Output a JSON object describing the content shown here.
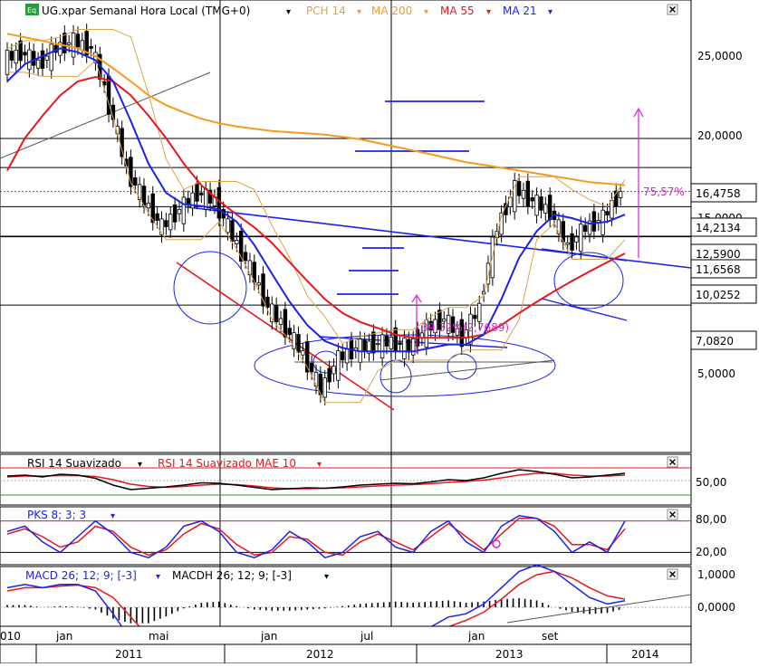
{
  "colors": {
    "pch": "#d9a44a",
    "ma200": "#f59a1f",
    "ma55": "#e8171c",
    "ma21": "#1b22e8",
    "annotation": "#e020d0",
    "rsi": "#000000",
    "rsi_mae": "#e8171c",
    "stoch_k": "#1b22e8",
    "stoch_d": "#e8171c",
    "macd": "#1b22e8",
    "signal": "#e8171c",
    "grid": "#000000",
    "background": "#ffffff"
  },
  "main_panel": {
    "icon_label": "Eq",
    "title": "UG.xpar Semanal Hora Local (TMG+0)",
    "legend": [
      {
        "label": "PCH 14",
        "color": "#d9a44a"
      },
      {
        "label": "MA 200",
        "color": "#f59a1f"
      },
      {
        "label": "MA 55",
        "color": "#e8171c"
      },
      {
        "label": "MA 21",
        "color": "#1b22e8"
      }
    ],
    "y_ticks": [
      "25,0000",
      "20,0000",
      "15,0000",
      "5,0000"
    ],
    "price_boxes": [
      "16,4758",
      "14,2134",
      "12,5900",
      "11,6568",
      "10,0252",
      "7,0820"
    ],
    "annotations": {
      "drop_pct": "39,32%(2,7689)",
      "rise_pct": "75,57%"
    },
    "close_icon": "close-icon"
  },
  "rsi_panel": {
    "legend": [
      {
        "label": "RSI 14 Suavizado",
        "color": "#000000"
      },
      {
        "label": "RSI 14 Suavizado MAE 10",
        "color": "#e8171c"
      }
    ],
    "y_ticks": [
      "50,00"
    ]
  },
  "stoch_panel": {
    "legend": [
      {
        "label": "PKS 8; 3; 3",
        "color": "#1b22e8"
      }
    ],
    "y_ticks": [
      "80,00",
      "20,00"
    ]
  },
  "macd_panel": {
    "legend": [
      {
        "label": "MACD 26; 12; 9; [-3]",
        "color": "#1b22e8"
      },
      {
        "label": "MACDH 26; 12; 9; [-3]",
        "color": "#000000"
      }
    ],
    "y_ticks": [
      "1,0000",
      "0,0000"
    ]
  },
  "x_axis": {
    "months": [
      "010",
      "jan",
      "mai",
      "jan",
      "jul",
      "jan",
      "set"
    ],
    "years": [
      "2011",
      "2012",
      "2013",
      "2014"
    ]
  },
  "chart_data": [
    {
      "type": "candlestick",
      "title": "UG.xpar Semanal Hora Local (TMG+0)",
      "ylim": [
        3.5,
        30.0
      ],
      "y_scale": "log",
      "x": [
        "2010-11",
        "2011-01",
        "2011-02",
        "2011-04",
        "2011-05",
        "2011-06",
        "2011-07",
        "2011-08",
        "2011-09",
        "2011-10",
        "2011-11",
        "2011-12",
        "2012-01",
        "2012-02",
        "2012-03",
        "2012-04",
        "2012-05",
        "2012-06",
        "2012-07",
        "2012-08",
        "2012-09",
        "2012-10",
        "2012-11",
        "2012-12",
        "2013-01",
        "2013-02",
        "2013-03",
        "2013-04",
        "2013-05",
        "2013-06",
        "2013-07",
        "2013-08",
        "2013-09",
        "2013-10",
        "2013-11",
        "2013-12"
      ],
      "close": [
        24.5,
        25.5,
        24.0,
        26.0,
        27.0,
        26.0,
        19.5,
        14.0,
        12.0,
        10.5,
        11.5,
        12.5,
        12.0,
        10.0,
        8.5,
        7.0,
        6.3,
        5.5,
        4.6,
        5.4,
        5.7,
        5.8,
        5.9,
        5.7,
        6.3,
        6.6,
        6.0,
        7.0,
        10.5,
        12.8,
        12.0,
        11.4,
        9.5,
        10.5,
        11.0,
        12.6
      ],
      "ma21": [
        22.0,
        24.0,
        25.0,
        26.0,
        25.5,
        24.5,
        22.0,
        18.0,
        14.5,
        12.5,
        11.8,
        11.7,
        11.5,
        10.8,
        9.6,
        8.3,
        7.2,
        6.4,
        5.9,
        5.7,
        5.6,
        5.6,
        5.6,
        5.6,
        5.7,
        5.8,
        5.8,
        6.1,
        7.3,
        9.0,
        10.3,
        11.2,
        11.0,
        10.7,
        10.8,
        11.2
      ],
      "ma55": [
        14.0,
        16.5,
        18.5,
        20.5,
        22.0,
        22.5,
        22.0,
        20.5,
        18.5,
        16.5,
        14.5,
        13.0,
        12.0,
        11.2,
        10.5,
        9.7,
        8.8,
        8.0,
        7.3,
        6.8,
        6.5,
        6.3,
        6.1,
        6.0,
        6.0,
        6.0,
        6.0,
        6.1,
        6.4,
        6.8,
        7.2,
        7.6,
        8.0,
        8.4,
        8.8,
        9.2
      ],
      "ma200": [
        28.0,
        27.5,
        27.0,
        26.5,
        26.0,
        25.0,
        23.5,
        22.0,
        20.5,
        19.5,
        18.8,
        18.2,
        17.8,
        17.5,
        17.3,
        17.1,
        17.0,
        16.9,
        16.8,
        16.6,
        16.4,
        16.1,
        15.8,
        15.5,
        15.2,
        14.9,
        14.6,
        14.4,
        14.2,
        14.0,
        13.8,
        13.6,
        13.4,
        13.2,
        13.1,
        13.0
      ],
      "horizontal_levels": [
        16.4758,
        14.2134,
        12.59,
        11.6568,
        10.0252,
        7.082
      ],
      "annotations": [
        "39,32%(2,7689)",
        "75,57%"
      ]
    },
    {
      "type": "line",
      "series": [
        {
          "name": "RSI 14 Suavizado"
        },
        {
          "name": "RSI 14 Suavizado MAE 10"
        }
      ],
      "y_ticks": [
        50
      ],
      "rsi": [
        60,
        62,
        58,
        64,
        62,
        55,
        40,
        30,
        33,
        36,
        40,
        45,
        44,
        40,
        35,
        30,
        32,
        34,
        33,
        36,
        40,
        42,
        44,
        43,
        47,
        52,
        50,
        56,
        66,
        74,
        70,
        64,
        56,
        58,
        62,
        66
      ],
      "rsi_mae": [
        58,
        60,
        60,
        61,
        61,
        59,
        52,
        42,
        37,
        35,
        37,
        40,
        42,
        41,
        38,
        34,
        32,
        32,
        33,
        34,
        36,
        38,
        40,
        41,
        43,
        46,
        48,
        51,
        56,
        62,
        66,
        66,
        62,
        60,
        60,
        62
      ]
    },
    {
      "type": "line",
      "series": [
        {
          "name": "PKS 8; 3; 3"
        }
      ],
      "y_ticks": [
        80,
        20
      ],
      "k": [
        60,
        70,
        40,
        20,
        50,
        80,
        55,
        20,
        10,
        30,
        70,
        80,
        60,
        20,
        10,
        25,
        60,
        40,
        10,
        20,
        50,
        60,
        30,
        20,
        60,
        80,
        40,
        20,
        70,
        90,
        85,
        60,
        20,
        40,
        20,
        80
      ],
      "d": [
        55,
        65,
        50,
        30,
        40,
        70,
        60,
        30,
        15,
        25,
        55,
        75,
        65,
        35,
        15,
        20,
        50,
        45,
        20,
        15,
        40,
        55,
        40,
        25,
        50,
        75,
        50,
        25,
        55,
        85,
        85,
        70,
        35,
        35,
        25,
        65
      ]
    },
    {
      "type": "bar",
      "series": [
        {
          "name": "MACD 26; 12; 9; [-3]"
        },
        {
          "name": "MACDH 26; 12; 9; [-3]"
        }
      ],
      "y_ticks": [
        1.0,
        0.0
      ],
      "macd": [
        0.6,
        0.7,
        0.6,
        0.7,
        0.7,
        0.5,
        -0.2,
        -1.0,
        -1.6,
        -1.7,
        -1.5,
        -1.2,
        -1.0,
        -1.1,
        -1.3,
        -1.5,
        -1.6,
        -1.6,
        -1.6,
        -1.5,
        -1.3,
        -1.1,
        -0.9,
        -0.8,
        -0.6,
        -0.3,
        -0.2,
        0.1,
        0.6,
        1.1,
        1.3,
        1.1,
        0.7,
        0.3,
        0.1,
        0.2
      ],
      "signal": [
        0.5,
        0.6,
        0.6,
        0.65,
        0.68,
        0.6,
        0.3,
        -0.3,
        -0.9,
        -1.3,
        -1.45,
        -1.4,
        -1.25,
        -1.15,
        -1.2,
        -1.35,
        -1.45,
        -1.5,
        -1.55,
        -1.55,
        -1.45,
        -1.3,
        -1.15,
        -1.0,
        -0.85,
        -0.6,
        -0.4,
        -0.15,
        0.25,
        0.7,
        1.0,
        1.1,
        0.9,
        0.6,
        0.35,
        0.25
      ],
      "histogram": [
        0.1,
        0.1,
        0.0,
        0.05,
        0.02,
        -0.1,
        -0.5,
        -0.7,
        -0.7,
        -0.4,
        -0.05,
        0.2,
        0.25,
        0.05,
        -0.1,
        -0.15,
        -0.15,
        -0.1,
        -0.05,
        0.05,
        0.15,
        0.2,
        0.25,
        0.2,
        0.25,
        0.3,
        0.2,
        0.25,
        0.35,
        0.4,
        0.3,
        0.0,
        -0.2,
        -0.3,
        -0.25,
        -0.05
      ]
    }
  ]
}
